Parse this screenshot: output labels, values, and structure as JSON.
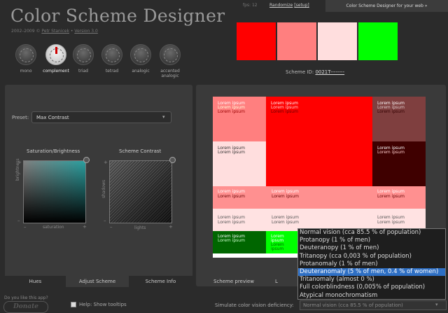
{
  "header": {
    "title": "Color Scheme Designer",
    "credits_years": "2002–2009 © ",
    "credits_author": "Petr Stanicek",
    "credits_sep": " • ",
    "credits_version": "Version 3.0",
    "fps": "fps: 12",
    "randomize": "Randomize",
    "setup": "[setup]",
    "web_tab": "Color Scheme Designer for your web »"
  },
  "scheme_types": [
    {
      "label": "mono",
      "active": false
    },
    {
      "label": "complement",
      "active": true
    },
    {
      "label": "triad",
      "active": false
    },
    {
      "label": "tetrad",
      "active": false
    },
    {
      "label": "analogic",
      "active": false
    },
    {
      "label": "accented analogic",
      "active": false
    }
  ],
  "colors": {
    "primary": "#ff0000",
    "primary_light": "#ff7f7f",
    "primary_pale": "#ffdede",
    "complement": "#00ff00",
    "dark_red": "#7f3f3f",
    "very_dark_red": "#3f0000",
    "dark_green": "#006600",
    "pink_row": "#ff9090",
    "pale_row": "#ffe2e2"
  },
  "scheme_id": {
    "label": "Scheme ID: ",
    "value": "0021T--------"
  },
  "adjust": {
    "preset_label": "Preset:",
    "preset_value": "Max Contrast",
    "sat_bright_title": "Saturation/Brightness",
    "contrast_title": "Scheme Contrast",
    "saturation_axis": "saturation",
    "brightness_axis": "brightness",
    "lights_axis": "lights",
    "shadows_axis": "shadows",
    "minus": "–",
    "plus": "+"
  },
  "left_tabs": {
    "hues": "Hues",
    "adjust": "Adjust Scheme",
    "info": "Scheme Info"
  },
  "preview": {
    "lorem": "Lorem ipsum",
    "tab_preview": "Scheme preview",
    "tab_l": "L"
  },
  "vision": {
    "options": [
      "Normal vision (cca 85.5 % of population)",
      "Protanopy (1 % of men)",
      "Deuteranopy (1 % of men)",
      "Tritanopy (cca 0,003 % of population)",
      "Protanomaly (1 % of men)",
      "Deuteranomaly (5 % of men, 0.4 % of women)",
      "Tritanomaly (almost 0 %)",
      "Full colorblindness (0,005% of population)",
      "Atypical monochromatism"
    ],
    "selected_index": 5
  },
  "footer": {
    "like": "Do you like this app?",
    "donate": "Donate",
    "help": "Help: Show tooltips",
    "simulate_label": "Simulate color vision deficiency:",
    "simulate_value": "Normal vision (cca 85.5 % of population)"
  }
}
